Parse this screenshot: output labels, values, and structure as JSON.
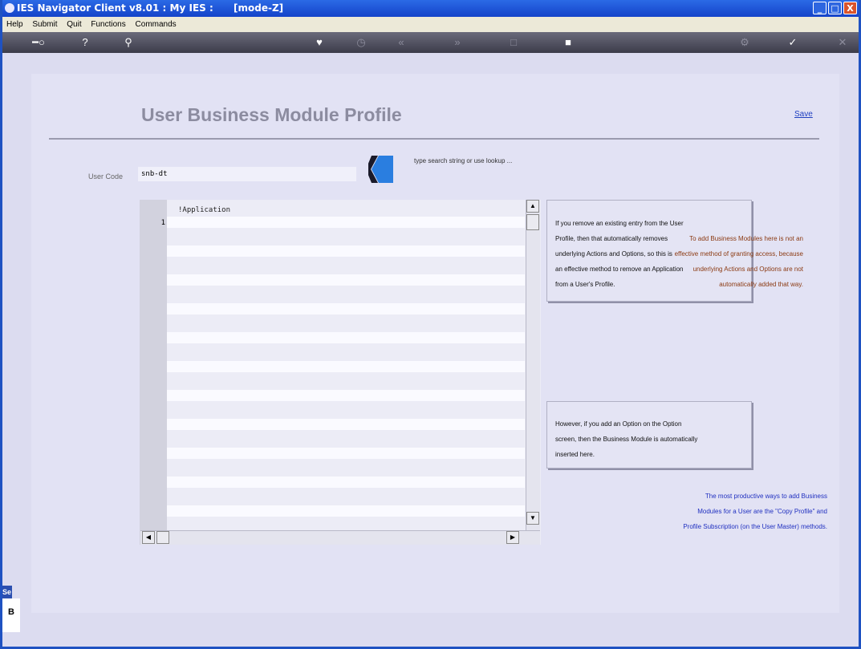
{
  "window": {
    "title": "IES Navigator Client v8.01 : My IES :",
    "mode": "[mode-Z]",
    "controls": {
      "minimize": "_",
      "maximize": "□",
      "close": "X"
    }
  },
  "menu": {
    "items": [
      "Help",
      "Submit",
      "Quit",
      "Functions",
      "Commands"
    ]
  },
  "toolbar": {
    "icons": [
      "key-icon",
      "help-icon",
      "search-icon",
      "heart-icon",
      "clock-icon",
      "rewind-icon",
      "forward-icon",
      "stop-icon",
      "square-icon",
      "settings-icon",
      "check-icon",
      "close-icon"
    ]
  },
  "page": {
    "title": "User Business Module Profile",
    "save_label": "Save",
    "search_hint": "type search string or use lookup ...",
    "user_code_label": "User Code",
    "user_code_value": "snb-dt"
  },
  "grid": {
    "column_header": "!Application",
    "first_row_number": "1"
  },
  "notes": {
    "box1": [
      "If you remove an existing entry from the User",
      "Profile, then that automatically removes",
      "underlying Actions and Options, so this is",
      "an effective method to remove an Application",
      "from a User's Profile."
    ],
    "text2": [
      "To add Business Modules here is not an",
      "effective method of granting access, because",
      "underlying Actions and Options are not",
      "automatically added that way."
    ],
    "box3": [
      "However, if you add an Option on the Option",
      "screen, then the Business Module is automatically",
      "inserted here."
    ],
    "text4": [
      "The most productive ways to add Business",
      "Modules for a User are the \"Copy Profile\" and",
      "Profile Subscription (on the User Master) methods."
    ]
  },
  "side_stub": {
    "label_top": "Se",
    "label_bottom": "B"
  },
  "colors": {
    "title_bar": "#1443c9",
    "page_title": "#8c8ca0",
    "note_brown": "#8b3a12",
    "note_blue": "#2030c0",
    "link": "#2040c0"
  }
}
